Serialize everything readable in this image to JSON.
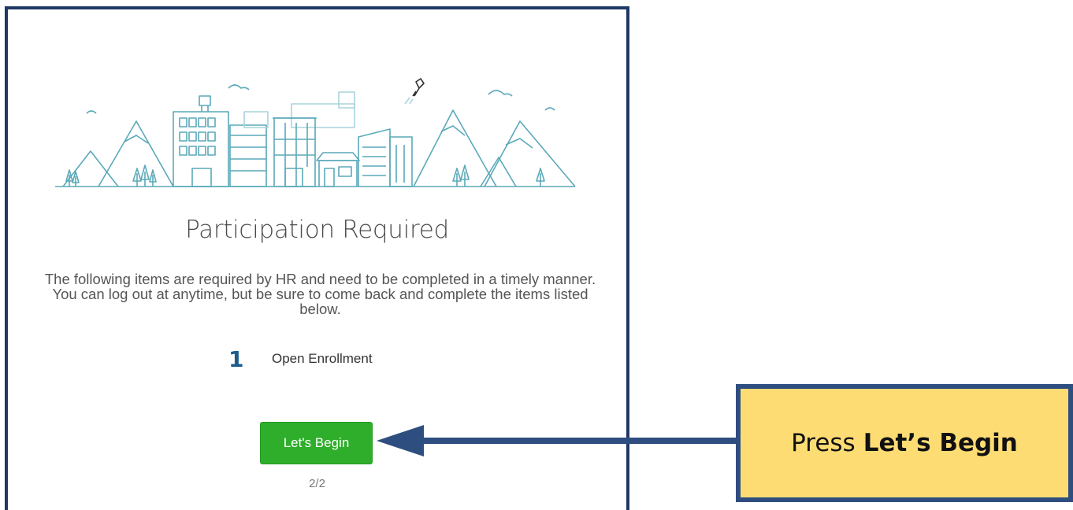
{
  "dialog": {
    "title": "Participation Required",
    "description": "The following items are required by HR and need to be completed in a timely manner. You can log out at anytime, but be sure to come back and complete the items listed below.",
    "items": [
      {
        "number": "1",
        "label": "Open Enrollment"
      }
    ],
    "begin_button": "Let's Begin",
    "pager": "2/2"
  },
  "annotation": {
    "prefix": "Press",
    "emphasis": "Let’s Begin"
  },
  "colors": {
    "illustration_line": "#5aa9b9",
    "button": "#2fae2b",
    "callout_fill": "#fedc74",
    "callout_border": "#2e4e80",
    "arrow": "#2e4e80"
  },
  "icons": [
    "city-skyline-illustration",
    "jetpack-person-icon",
    "arrow-left-icon"
  ]
}
